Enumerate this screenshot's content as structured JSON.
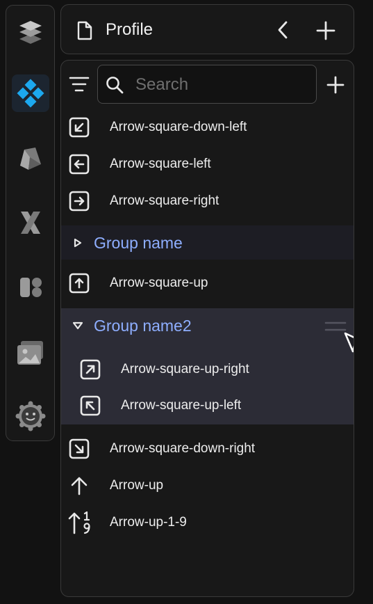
{
  "header": {
    "title": "Profile"
  },
  "search": {
    "placeholder": "Search"
  },
  "items_top": [
    {
      "label": "Arrow-square-down-left",
      "icon": "arrow-square-down-left-icon"
    },
    {
      "label": "Arrow-square-left",
      "icon": "arrow-square-left-icon"
    },
    {
      "label": "Arrow-square-right",
      "icon": "arrow-square-right-icon"
    }
  ],
  "group1": {
    "name": "Group name",
    "expanded": false,
    "items": [
      {
        "label": "Arrow-square-up",
        "icon": "arrow-square-up-icon"
      }
    ]
  },
  "group2": {
    "name": "Group name2",
    "expanded": true,
    "items": [
      {
        "label": "Arrow-square-up-right",
        "icon": "arrow-square-up-right-icon"
      },
      {
        "label": "Arrow-square-up-left",
        "icon": "arrow-square-up-left-icon"
      }
    ]
  },
  "items_bottom": [
    {
      "label": "Arrow-square-down-right",
      "icon": "arrow-square-down-right-icon"
    },
    {
      "label": "Arrow-up",
      "icon": "arrow-up-icon"
    },
    {
      "label": "Arrow-up-1-9",
      "icon": "arrow-up-1-9-icon"
    }
  ],
  "rail": [
    "layers-icon",
    "components-icon",
    "shapes-icon",
    "variables-icon",
    "assets-icon",
    "images-icon",
    "plugins-icon"
  ],
  "colors": {
    "accent": "#8eaeff",
    "active_rail": "#1c2530",
    "group2_bg": "#2c2c36",
    "group1_bg": "#1d1d24"
  }
}
